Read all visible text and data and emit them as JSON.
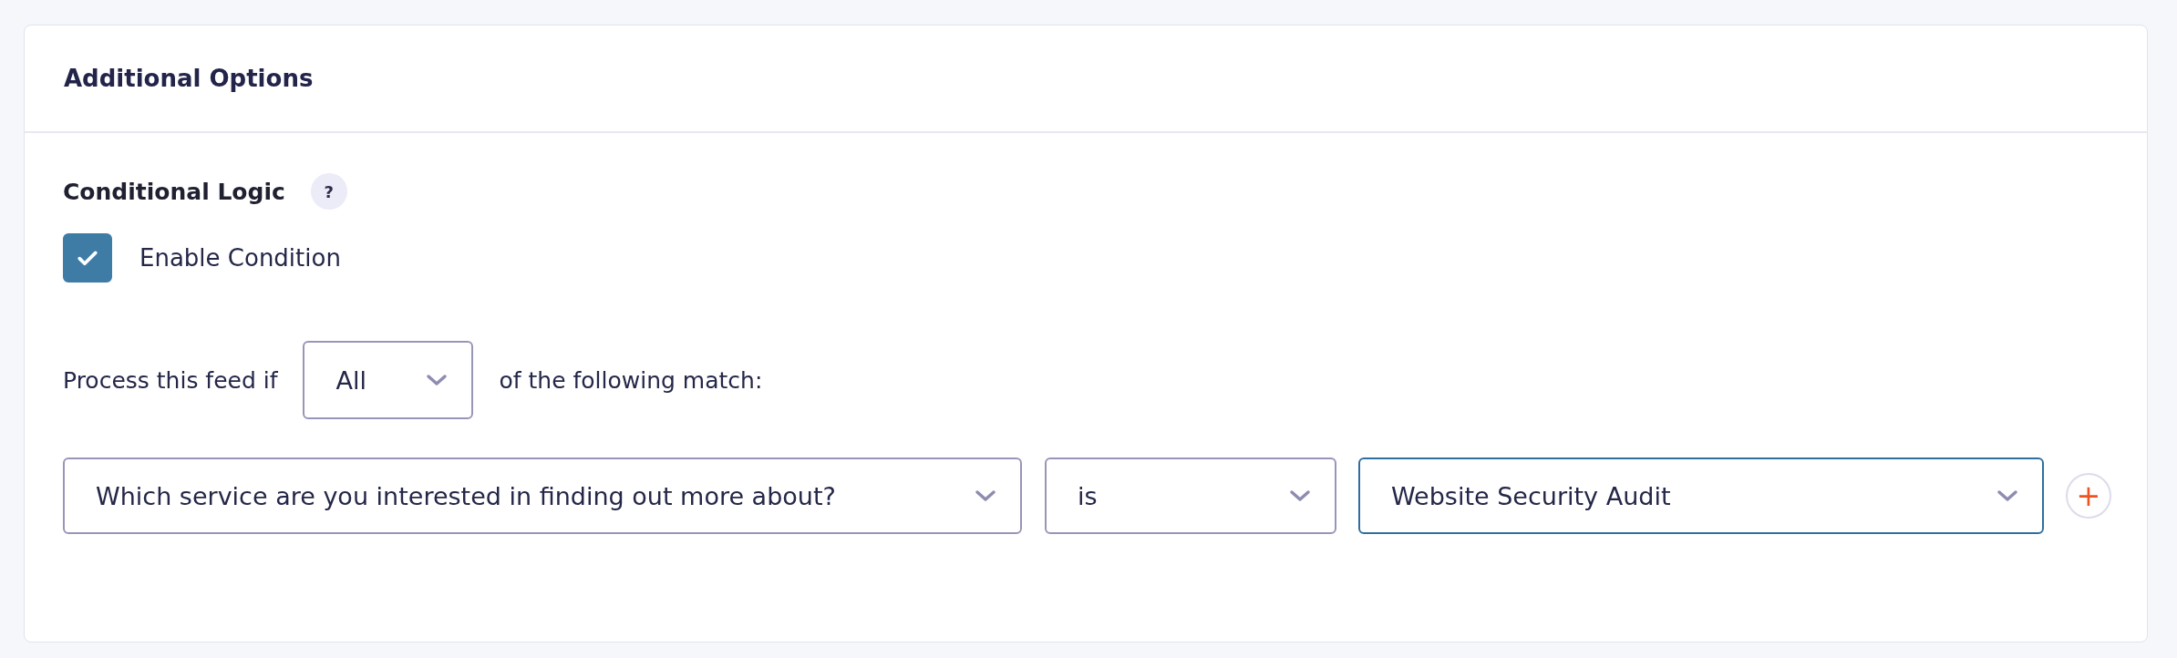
{
  "panel": {
    "title": "Additional Options"
  },
  "conditional_logic": {
    "label": "Conditional Logic",
    "help": "?",
    "enable": {
      "label": "Enable Condition",
      "checked": true
    }
  },
  "match_line": {
    "prefix": "Process this feed if",
    "mode": "All",
    "suffix": "of the following match:"
  },
  "rules": [
    {
      "field": "Which service are you interested in finding out more about?",
      "operator": "is",
      "value": "Website Security Audit",
      "focused": true
    }
  ],
  "add_button": "+"
}
